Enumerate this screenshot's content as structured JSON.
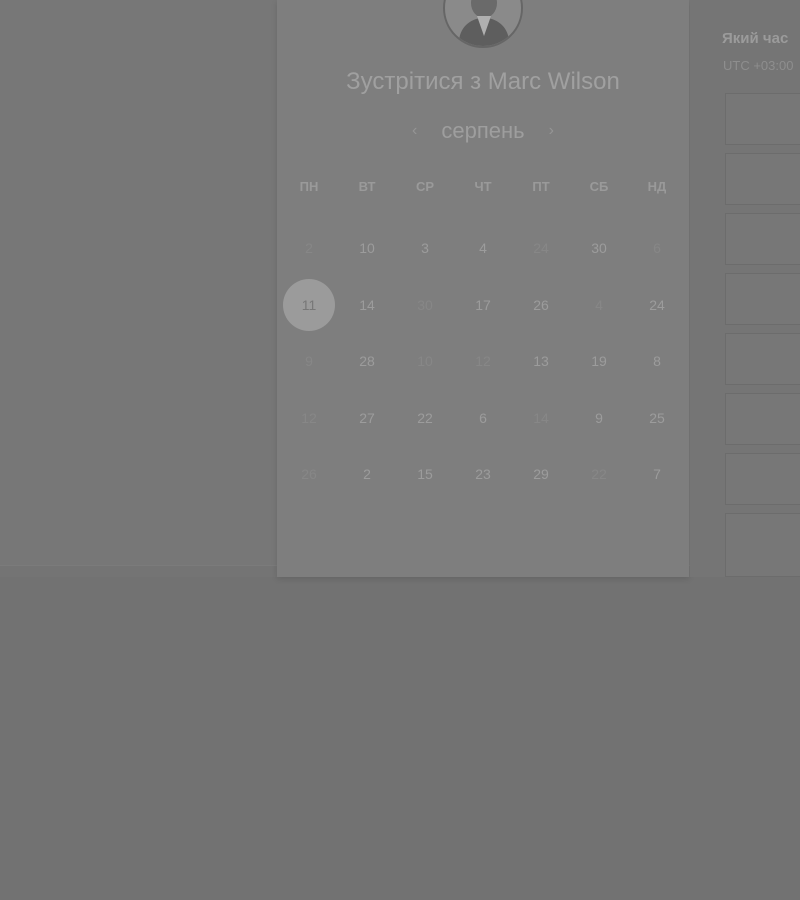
{
  "booking": {
    "title": "Зустрітися з Marc Wilson",
    "month": "серпень",
    "prev_icon": "chevron-left-icon",
    "next_icon": "chevron-right-icon",
    "weekdays": [
      "ПН",
      "ВТ",
      "СР",
      "ЧТ",
      "ПТ",
      "СБ",
      "НД"
    ],
    "weeks": [
      [
        {
          "d": "2",
          "a": false
        },
        {
          "d": "10",
          "a": true
        },
        {
          "d": "3",
          "a": true
        },
        {
          "d": "4",
          "a": true
        },
        {
          "d": "24",
          "a": false
        },
        {
          "d": "30",
          "a": true
        },
        {
          "d": "6",
          "a": false
        }
      ],
      [
        {
          "d": "11",
          "a": true,
          "sel": true
        },
        {
          "d": "14",
          "a": true
        },
        {
          "d": "30",
          "a": false
        },
        {
          "d": "17",
          "a": true
        },
        {
          "d": "26",
          "a": true
        },
        {
          "d": "4",
          "a": false
        },
        {
          "d": "24",
          "a": true
        }
      ],
      [
        {
          "d": "9",
          "a": false
        },
        {
          "d": "28",
          "a": true
        },
        {
          "d": "10",
          "a": false
        },
        {
          "d": "12",
          "a": false
        },
        {
          "d": "13",
          "a": true
        },
        {
          "d": "19",
          "a": true
        },
        {
          "d": "8",
          "a": true
        }
      ],
      [
        {
          "d": "12",
          "a": false
        },
        {
          "d": "27",
          "a": true
        },
        {
          "d": "22",
          "a": true
        },
        {
          "d": "6",
          "a": true
        },
        {
          "d": "14",
          "a": false
        },
        {
          "d": "9",
          "a": true
        },
        {
          "d": "25",
          "a": true
        }
      ],
      [
        {
          "d": "26",
          "a": false
        },
        {
          "d": "2",
          "a": true
        },
        {
          "d": "15",
          "a": true
        },
        {
          "d": "23",
          "a": true
        },
        {
          "d": "29",
          "a": true
        },
        {
          "d": "22",
          "a": false
        },
        {
          "d": "7",
          "a": true
        }
      ]
    ]
  },
  "side": {
    "title": "Який час",
    "timezone": "UTC +03:00"
  }
}
